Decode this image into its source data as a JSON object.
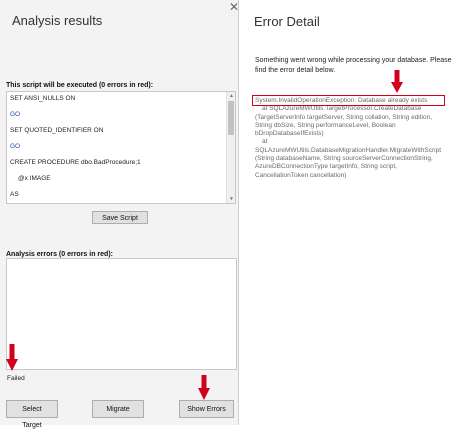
{
  "left_panel": {
    "title": "Analysis results",
    "script_label": "This script will be executed (0 errors in red):",
    "script_lines": [
      "SET ANSI_NULLS ON",
      "GO",
      "SET QUOTED_IDENTIFIER ON",
      "GO",
      "CREATE PROCEDURE dbo.BadProcedure;1",
      "@x IMAGE",
      "AS"
    ],
    "save_script_label": "Save Script",
    "errors_label": "Analysis errors (0 errors in red):",
    "status_text": "Failed",
    "buttons": {
      "select_target": "Select Target",
      "migrate": "Migrate",
      "show_errors": "Show Errors"
    }
  },
  "right_panel": {
    "title": "Error Detail",
    "intro": "Something went wrong while processing your database. Please find the error detail below.",
    "error_lines": [
      "System.InvalidOperationException: Database already exists",
      "    at SQLAzureMWUtils.TargetProcessor.CreateDatabase",
      "(TargetServerInfo targetServer, String collation, String edition,",
      "String dbSize, String performanceLevel, Boolean",
      "bDropDatabaseIfExists)",
      "    at",
      "SQLAzureMWUtils.DatabaseMigrationHandler.MigrateWithScript",
      "(String databaseName, String sourceServerConnectionString,",
      "AzureDBConnectionType targetInfo, String script,",
      "CancellationToken cancellation)"
    ]
  },
  "icons": {
    "close": "close-icon",
    "annotation_arrow": "down-arrow-icon",
    "scroll_up": "chevron-up-icon",
    "scroll_down": "chevron-down-icon"
  },
  "colors": {
    "keyword_blue": "#1f3fb5",
    "annotation_red": "#d0021b",
    "error_text_gray": "#6a6a6a",
    "panel_background": "#f3f3f3"
  }
}
